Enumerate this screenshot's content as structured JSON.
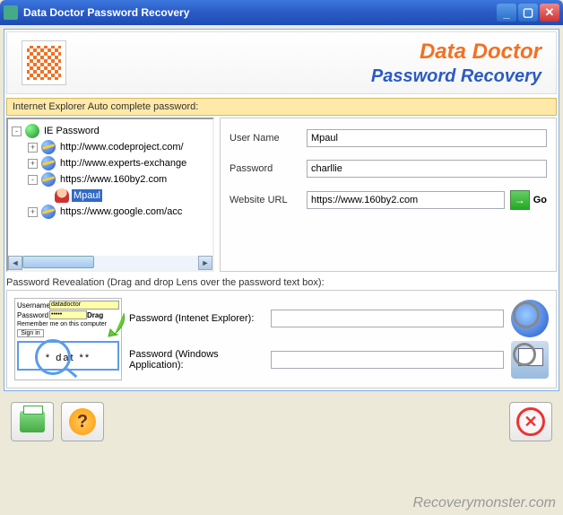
{
  "window": {
    "title": "Data Doctor Password Recovery"
  },
  "header": {
    "line1": "Data Doctor",
    "line2": "Password Recovery"
  },
  "section1_label": "Internet Explorer Auto complete password:",
  "tree": {
    "root": "IE Password",
    "items": [
      "http://www.codeproject.com/",
      "http://www.experts-exchange",
      "https://www.160by2.com",
      "https://www.google.com/acc"
    ],
    "selected_user": "Mpaul"
  },
  "form": {
    "username_label": "User Name",
    "username_value": "Mpaul",
    "password_label": "Password",
    "password_value": "charllie",
    "url_label": "Website URL",
    "url_value": "https://www.160by2.com",
    "go_label": "Go"
  },
  "reveal": {
    "label": "Password Revealation (Drag and drop Lens over the password text box):",
    "demo_username_label": "Username",
    "demo_username_value": "datadoctor",
    "demo_password_label": "Password",
    "demo_drag": "Drag",
    "demo_remember": "Remember me on this computer",
    "demo_signin": "Sign in",
    "magnify_text": "* dat **",
    "ie_label": "Password (Intenet Explorer):",
    "win_label": "Password (Windows Application):"
  },
  "watermark": "Recoverymonster.com"
}
